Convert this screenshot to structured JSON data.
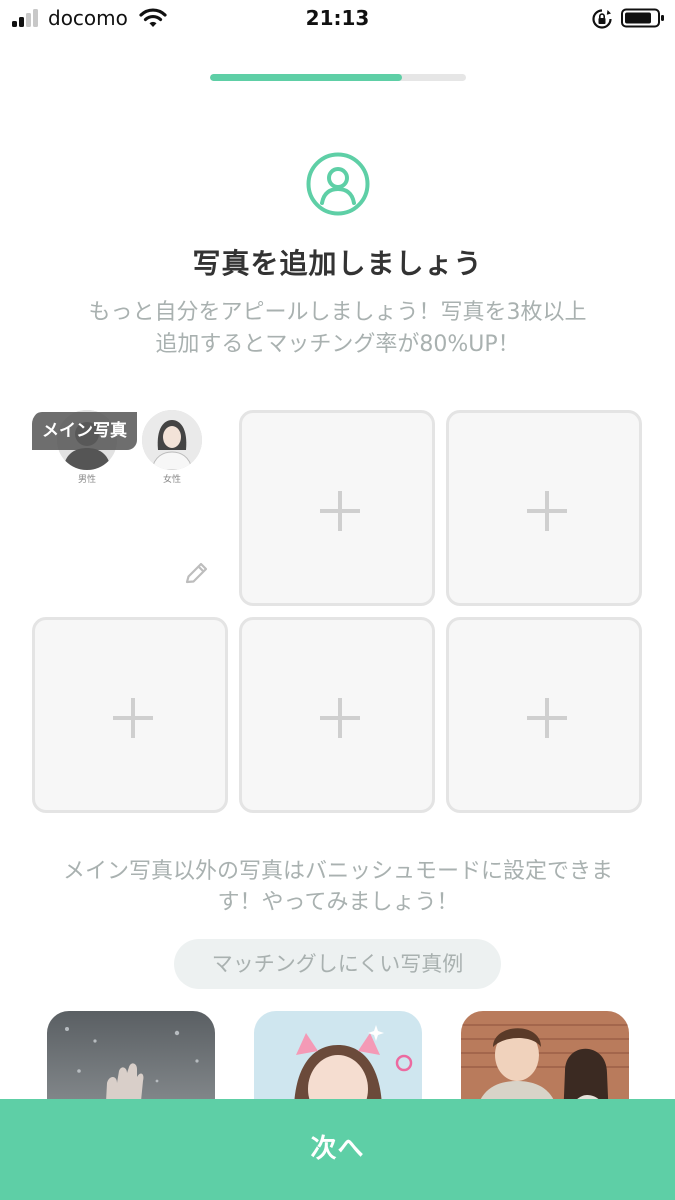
{
  "status_bar": {
    "carrier": "docomo",
    "time": "21:13",
    "signal_bars": 4,
    "signal_bars_active": 2,
    "icons": [
      "signal-icon",
      "wifi-icon",
      "rotation-lock-icon",
      "battery-icon"
    ]
  },
  "progress": {
    "value": 0.75
  },
  "header": {
    "icon": "user-profile-icon",
    "title": "写真を追加しましょう",
    "subtitle_line1": "もっと自分をアピールしましょう！写真を3枚以上",
    "subtitle_line2": "追加するとマッチング率が80%UP！"
  },
  "photo_grid": {
    "main_badge": "メイン写真",
    "main_avatars": [
      {
        "caption": "男性"
      },
      {
        "caption": "女性"
      }
    ],
    "empty_slot_icon": "plus-icon",
    "edit_icon": "pencil-icon"
  },
  "vanish_note": {
    "line1": "メイン写真以外の写真はバニッシュモードに設定できま",
    "line2": "す！やってみましょう！"
  },
  "examples": {
    "label": "マッチングしにくい写真例",
    "cards": [
      "rainy-window-photo",
      "cat-filter-selfie-photo",
      "couple-photo"
    ]
  },
  "colors": {
    "accent": "#5ecfa6",
    "muted_text": "#a9b1b0",
    "slot_border": "#e4e4e4"
  },
  "footer": {
    "next_label": "次へ"
  }
}
